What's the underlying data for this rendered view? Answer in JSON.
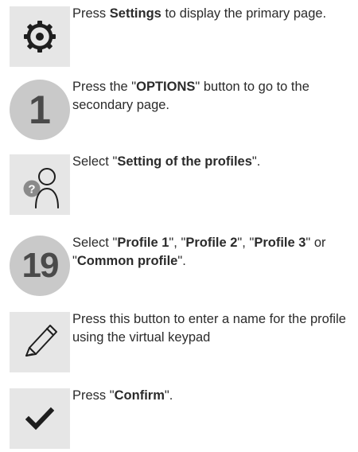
{
  "steps": [
    {
      "icon": "settings-gear-icon",
      "parts": [
        "Press ",
        "Settings",
        " to display the primary page."
      ]
    },
    {
      "icon": "number-badge",
      "badge": "1",
      "parts": [
        "Press the \"",
        "OPTIONS",
        "\" button to go to the secondary page."
      ]
    },
    {
      "icon": "profile-question-icon",
      "icon_text": "?",
      "parts": [
        "Select \"",
        "Setting of the profiles",
        "\"."
      ]
    },
    {
      "icon": "number-badge",
      "badge": "19",
      "parts": [
        "Select \"",
        "Profile 1",
        "\", \"",
        "Profile 2",
        "\", \"",
        "Profile 3",
        "\" or \"",
        "Common profile",
        "\"."
      ]
    },
    {
      "icon": "pencil-icon",
      "parts": [
        "Press this button to enter a name for the profile using the virtual keypad"
      ]
    },
    {
      "icon": "checkmark-icon",
      "parts": [
        "Press \"",
        "Confirm",
        "\"."
      ]
    }
  ],
  "colors": {
    "icon_box_bg": "#e6e6e6",
    "badge_bg": "#c9c9c9",
    "icon_stroke": "#1e1e1e"
  }
}
